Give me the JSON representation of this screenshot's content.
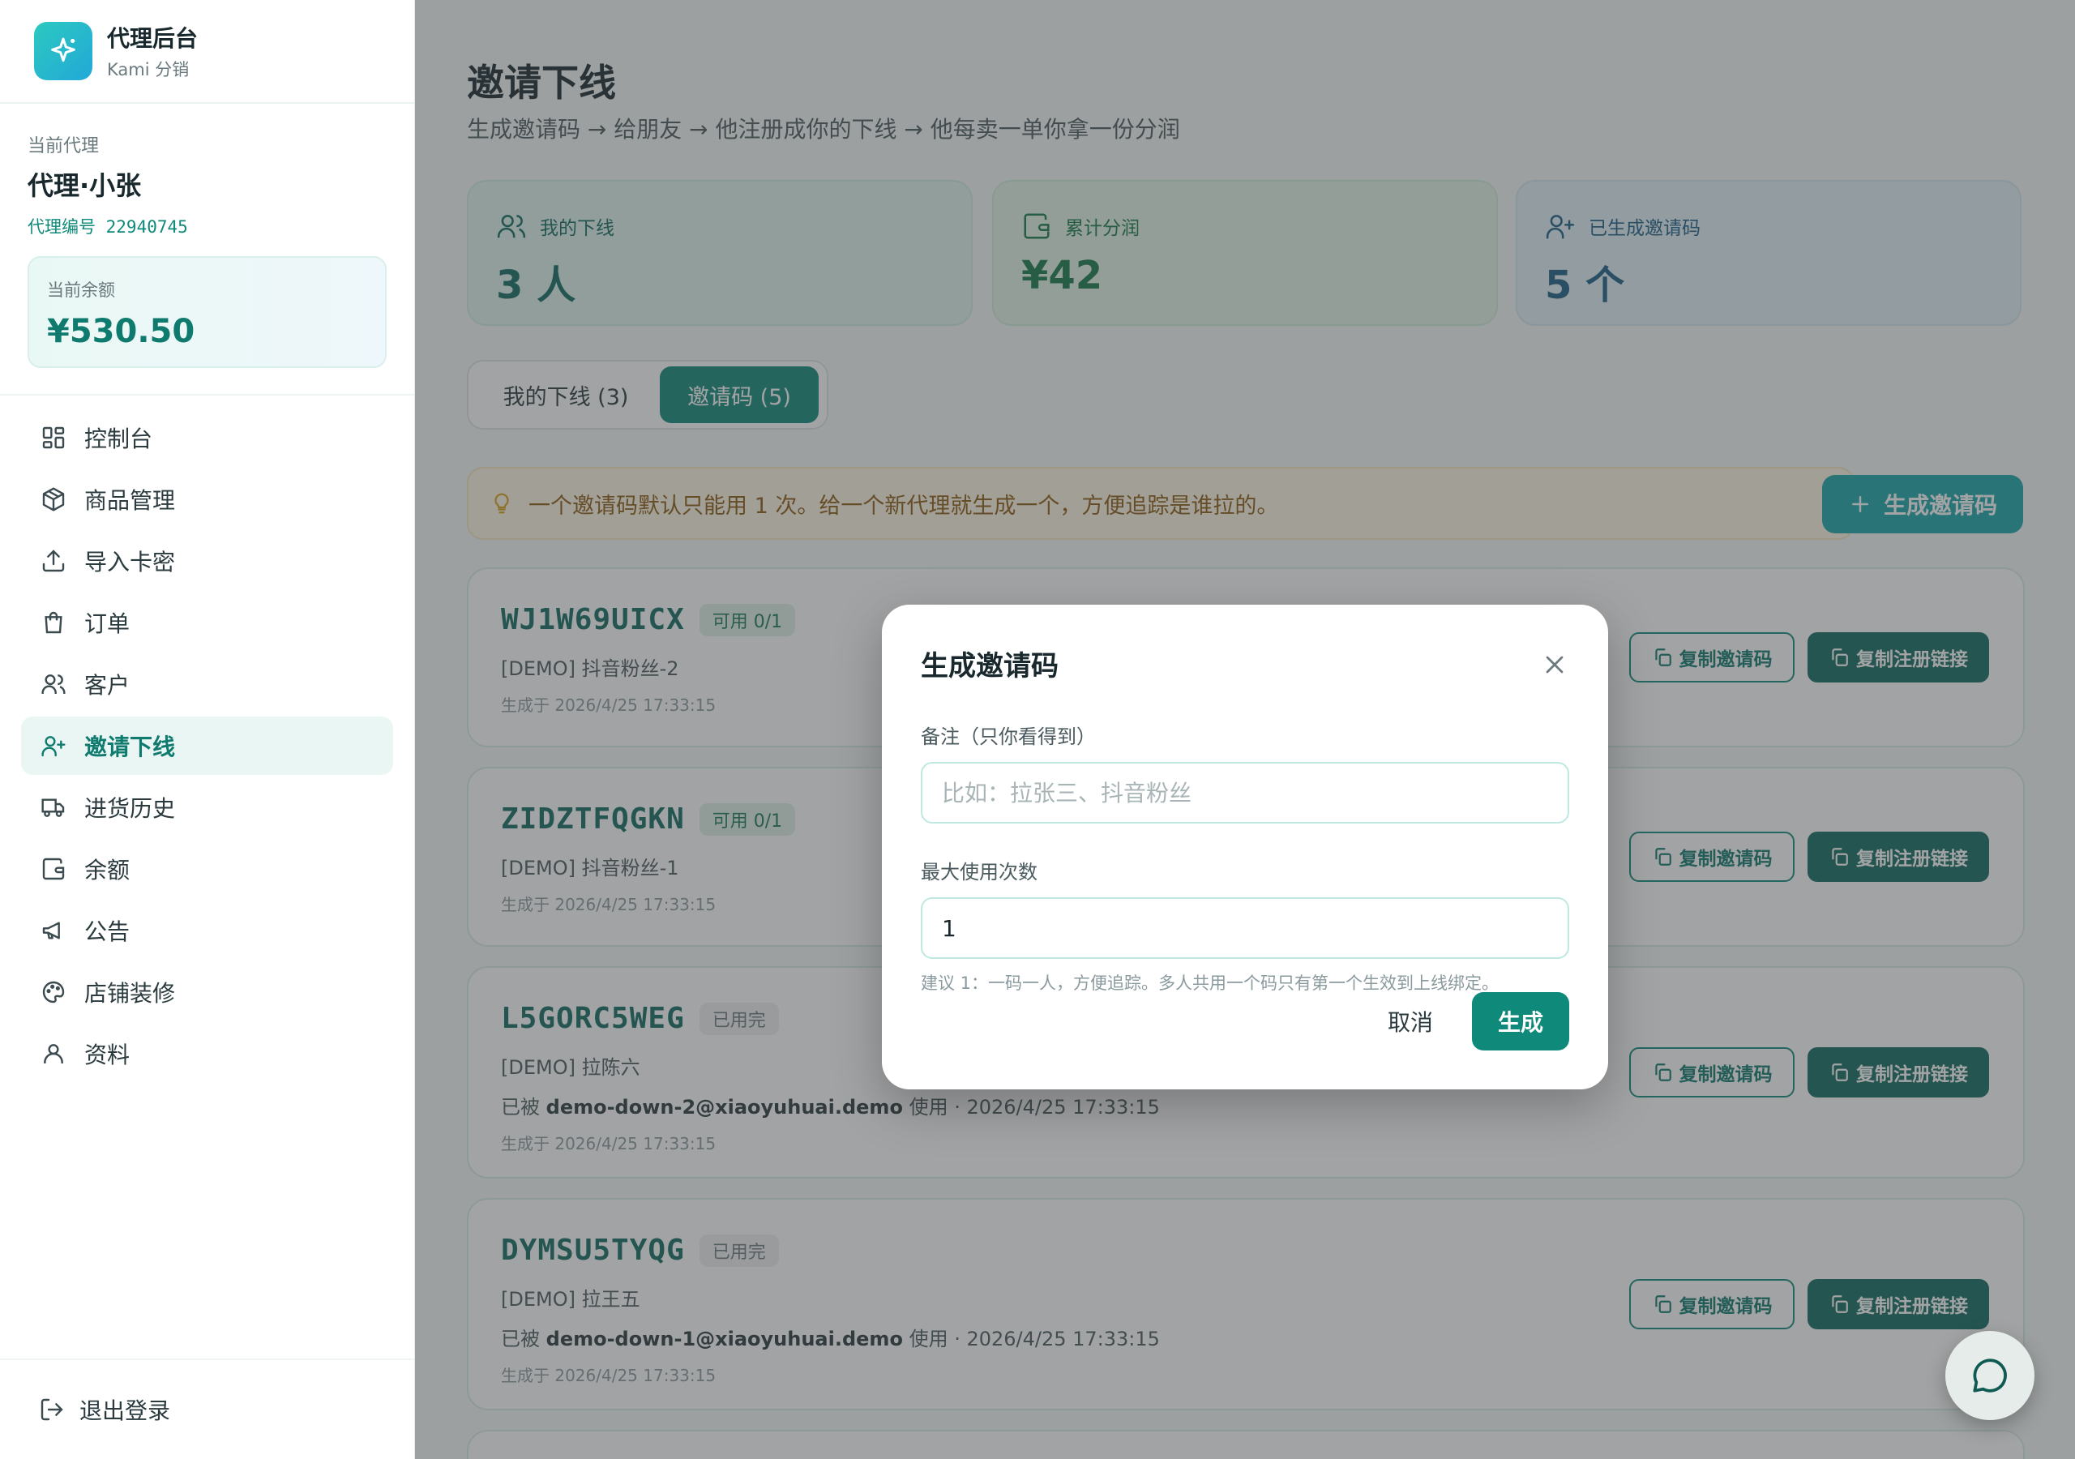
{
  "brand": {
    "title": "代理后台",
    "subtitle": "Kami 分销"
  },
  "agent": {
    "label": "当前代理",
    "name": "代理·小张",
    "id_text": "代理编号 22940745",
    "balance_label": "当前余额",
    "balance": "¥530.50"
  },
  "nav": [
    {
      "label": "控制台",
      "icon": "dashboard-icon"
    },
    {
      "label": "商品管理",
      "icon": "package-icon"
    },
    {
      "label": "导入卡密",
      "icon": "upload-icon"
    },
    {
      "label": "订单",
      "icon": "shopping-bag-icon"
    },
    {
      "label": "客户",
      "icon": "users-icon"
    },
    {
      "label": "邀请下线",
      "icon": "user-plus-icon",
      "active": true
    },
    {
      "label": "进货历史",
      "icon": "truck-icon"
    },
    {
      "label": "余额",
      "icon": "wallet-icon"
    },
    {
      "label": "公告",
      "icon": "megaphone-icon"
    },
    {
      "label": "店铺装修",
      "icon": "palette-icon"
    },
    {
      "label": "资料",
      "icon": "user-icon"
    }
  ],
  "logout": "退出登录",
  "page": {
    "title": "邀请下线",
    "subtitle": "生成邀请码 → 给朋友 → 他注册成你的下线 → 他每卖一单你拿一份分润"
  },
  "stats": [
    {
      "label": "我的下线",
      "value": "3 人",
      "icon": "users-icon",
      "color": "#0f6a5e"
    },
    {
      "label": "累计分润",
      "value": "¥42",
      "icon": "wallet-icon",
      "color": "#157a4a"
    },
    {
      "label": "已生成邀请码",
      "value": "5 个",
      "icon": "user-plus-icon",
      "color": "#1a5f86"
    }
  ],
  "tabs": {
    "downlines": "我的下线 (3)",
    "codes": "邀请码 (5)"
  },
  "tip": "一个邀请码默认只能用 1 次。给一个新代理就生成一个，方便追踪是谁拉的。",
  "generate_button": "生成邀请码",
  "cards": [
    {
      "code": "WJ1W69UICX",
      "badge": "可用 0/1",
      "status": "ok",
      "note": "[DEMO] 抖音粉丝-2",
      "used_prefix": "",
      "used_by": "",
      "used_suffix": "",
      "created": "生成于 2026/4/25 17:33:15"
    },
    {
      "code": "ZIDZTFQGKN",
      "badge": "可用 0/1",
      "status": "ok",
      "note": "[DEMO] 抖音粉丝-1",
      "used_prefix": "",
      "used_by": "",
      "used_suffix": "",
      "created": "生成于 2026/4/25 17:33:15"
    },
    {
      "code": "L5GORC5WEG",
      "badge": "已用完",
      "status": "done",
      "note": "[DEMO] 拉陈六",
      "used_prefix": "已被 ",
      "used_by": "demo-down-2@xiaoyuhuai.demo",
      "used_suffix": " 使用 · 2026/4/25 17:33:15",
      "created": "生成于 2026/4/25 17:33:15"
    },
    {
      "code": "DYMSU5TYQG",
      "badge": "已用完",
      "status": "done",
      "note": "[DEMO] 拉王五",
      "used_prefix": "已被 ",
      "used_by": "demo-down-1@xiaoyuhuai.demo",
      "used_suffix": " 使用 · 2026/4/25 17:33:15",
      "created": "生成于 2026/4/25 17:33:15"
    }
  ],
  "card_actions": {
    "copy_code": "复制邀请码",
    "copy_link": "复制注册链接"
  },
  "modal": {
    "title": "生成邀请码",
    "note_label": "备注（只你看得到）",
    "note_placeholder": "比如：拉张三、抖音粉丝",
    "max_label": "最大使用次数",
    "max_value": "1",
    "hint": "建议 1：一码一人，方便追踪。多人共用一个码只有第一个生效到上线绑定。",
    "cancel": "取消",
    "submit": "生成"
  },
  "colors": {
    "primary": "#0f8a7a",
    "accent": "#17a5a8"
  }
}
